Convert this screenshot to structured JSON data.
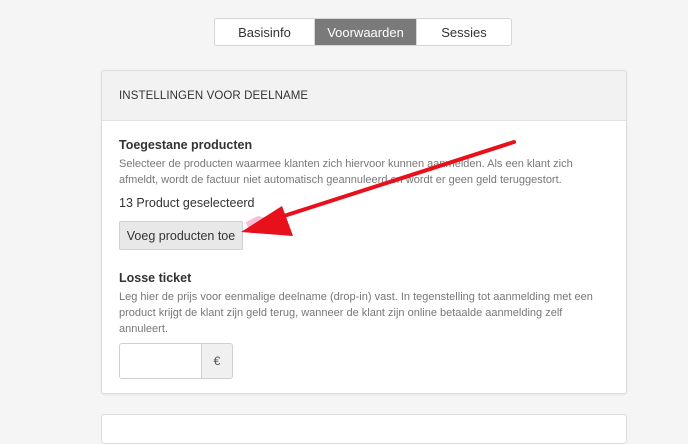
{
  "tabs": [
    {
      "label": "Basisinfo",
      "active": false
    },
    {
      "label": "Voorwaarden",
      "active": true
    },
    {
      "label": "Sessies",
      "active": false
    }
  ],
  "card": {
    "header": "INSTELLINGEN VOOR DEELNAME",
    "allowed_products": {
      "title": "Toegestane producten",
      "description": "Selecteer de producten waarmee klanten zich hiervoor kunnen aanmelden. Als een klant zich afmeldt, wordt de factuur niet automatisch geannuleerd en wordt er geen geld teruggestort.",
      "count_text": "13 Product geselecteerd",
      "add_button": "Voeg producten toe"
    },
    "single_ticket": {
      "title": "Losse ticket",
      "description": "Leg hier de prijs voor eenmalige deelname (drop-in) vast. In tegenstelling tot aanmelding met een product krijgt de klant zijn geld terug, wanneer de klant zijn online betaalde aanmelding zelf annuleert.",
      "price_value": "",
      "currency_symbol": "€"
    }
  },
  "annotation": {
    "arrow_color": "#e8101a",
    "highlight_color": "#f4a6c8"
  },
  "colors": {
    "active_tab_bg": "#7a7a7a",
    "page_bg": "#f5f5f5",
    "card_header_bg": "#f2f2f2"
  }
}
